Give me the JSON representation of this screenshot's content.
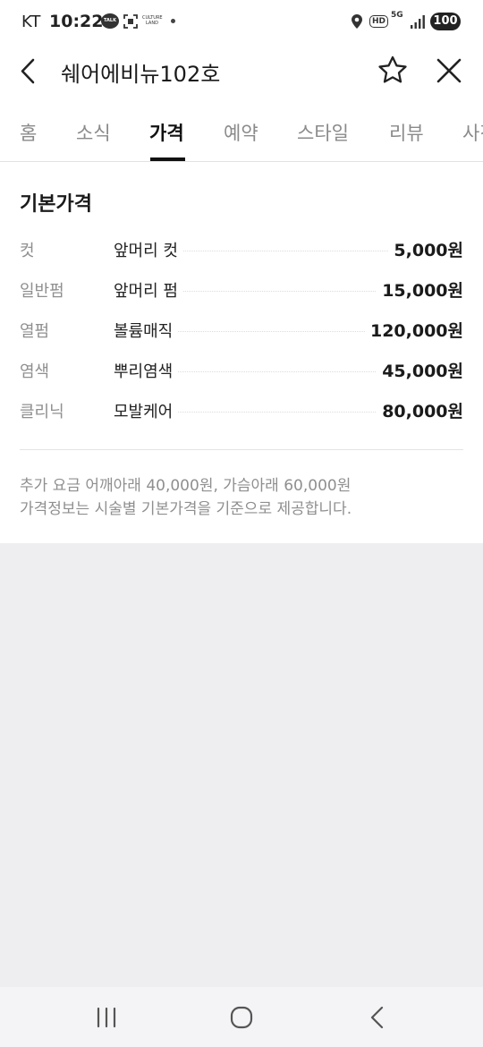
{
  "status_bar": {
    "carrier": "KT",
    "time": "10:22",
    "talk_badge": "TALK",
    "culture_badge": "CULTURE LAND",
    "hd_badge": "HD",
    "network": "5G",
    "battery": "100"
  },
  "header": {
    "title": "쉐어에비뉴102호"
  },
  "tabs": [
    {
      "label": "홈"
    },
    {
      "label": "소식"
    },
    {
      "label": "가격"
    },
    {
      "label": "예약"
    },
    {
      "label": "스타일"
    },
    {
      "label": "리뷰"
    },
    {
      "label": "사진"
    }
  ],
  "active_tab": "가격",
  "price_section": {
    "title": "기본가격",
    "rows": [
      {
        "category": "컷",
        "item": "앞머리 컷",
        "price": "5,000원"
      },
      {
        "category": "일반펌",
        "item": "앞머리 펌",
        "price": "15,000원"
      },
      {
        "category": "열펌",
        "item": "볼륨매직",
        "price": "120,000원"
      },
      {
        "category": "염색",
        "item": "뿌리염색",
        "price": "45,000원"
      },
      {
        "category": "클리닉",
        "item": "모발케어",
        "price": "80,000원"
      }
    ],
    "notes": [
      "추가 요금 어깨아래 40,000원, 가슴아래 60,000원",
      "가격정보는 시술별 기본가격을 기준으로 제공합니다."
    ]
  },
  "colors": {
    "accent": "#111111",
    "muted_text": "#8f8f8f",
    "background": "#eeeef0"
  }
}
